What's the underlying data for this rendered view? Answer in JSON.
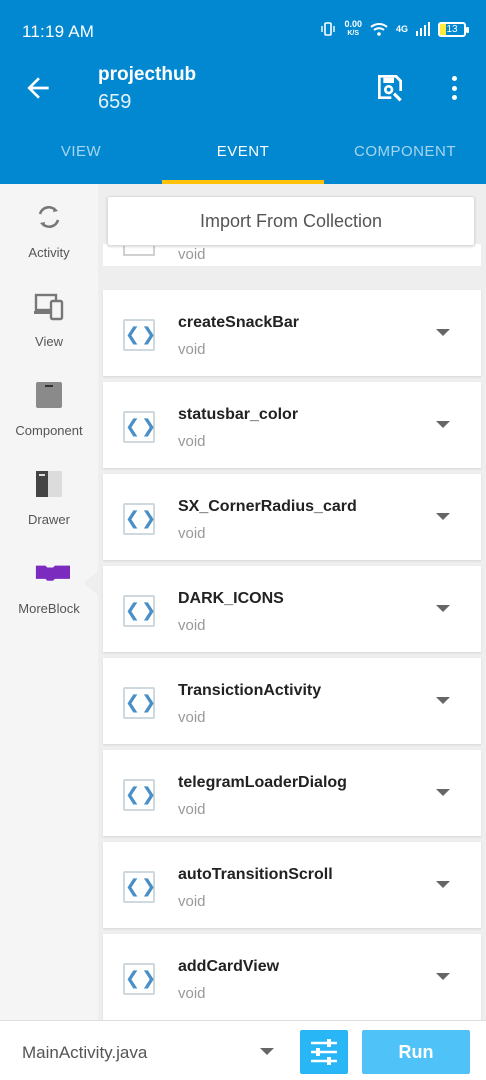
{
  "status_bar": {
    "time": "11:19 AM",
    "net_speed_value": "0.00",
    "net_speed_unit": "K/S",
    "network": "4G",
    "battery": "13"
  },
  "app_bar": {
    "title": "projecthub",
    "subtitle": "659"
  },
  "tabs": [
    {
      "label": "VIEW",
      "active": false
    },
    {
      "label": "EVENT",
      "active": true
    },
    {
      "label": "COMPONENT",
      "active": false
    }
  ],
  "sidebar": [
    {
      "label": "Activity",
      "icon": "sync-icon"
    },
    {
      "label": "View",
      "icon": "devices-icon"
    },
    {
      "label": "Component",
      "icon": "component-icon"
    },
    {
      "label": "Drawer",
      "icon": "drawer-icon"
    },
    {
      "label": "MoreBlock",
      "icon": "moreblock-icon",
      "active": true
    }
  ],
  "import_button": "Import From Collection",
  "partial_item": {
    "return_type": "void"
  },
  "moreblocks": [
    {
      "name": "createSnackBar",
      "return_type": "void"
    },
    {
      "name": "statusbar_color",
      "return_type": "void"
    },
    {
      "name": "SX_CornerRadius_card",
      "return_type": "void"
    },
    {
      "name": "DARK_ICONS",
      "return_type": "void"
    },
    {
      "name": "TransictionActivity",
      "return_type": "void"
    },
    {
      "name": "telegramLoaderDialog",
      "return_type": "void"
    },
    {
      "name": "autoTransitionScroll",
      "return_type": "void"
    },
    {
      "name": "addCardView",
      "return_type": "void"
    }
  ],
  "code_icon_glyph": "❮❯",
  "bottom_bar": {
    "file": "MainActivity.java",
    "run_label": "Run"
  },
  "colors": {
    "primary": "#0288d1",
    "accent": "#ffc107",
    "moreblock": "#7b2cbf",
    "run": "#4fc3f7"
  }
}
